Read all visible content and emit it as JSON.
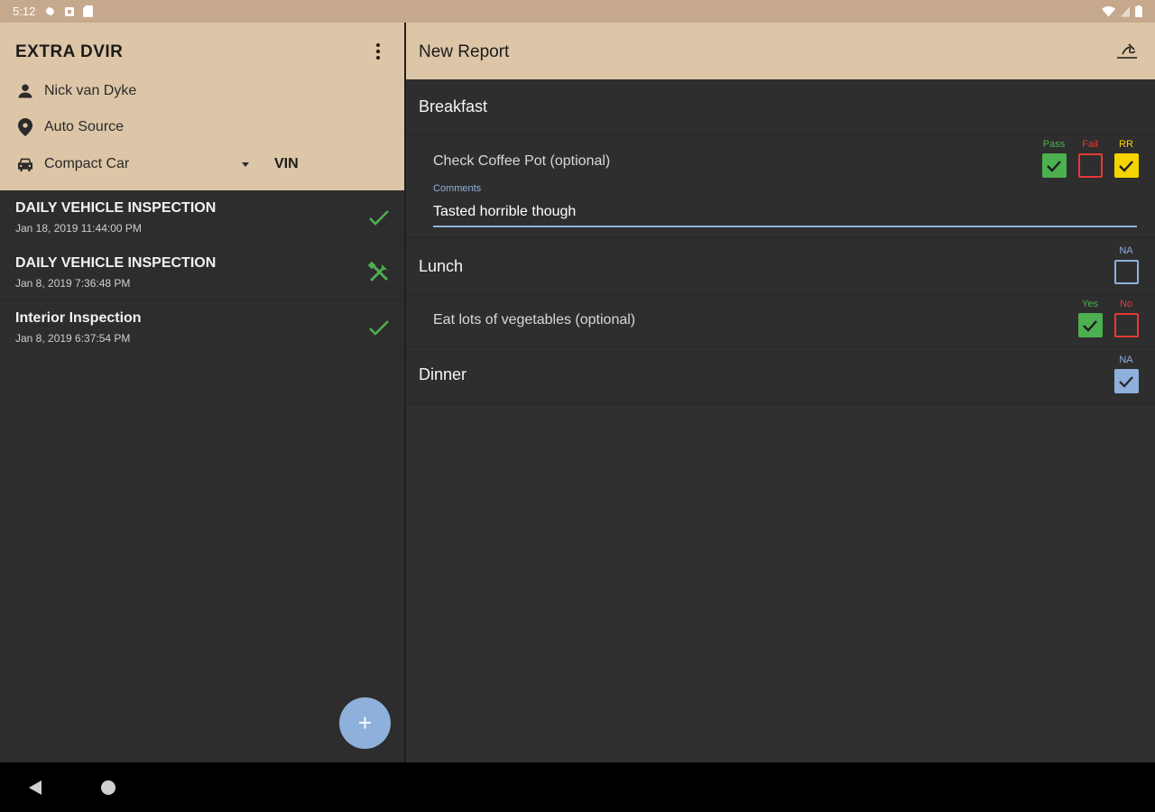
{
  "status_bar": {
    "time": "5:12"
  },
  "left_panel": {
    "app_title": "EXTRA DVIR",
    "driver_name": "Nick van Dyke",
    "location_source": "Auto Source",
    "vehicle": "Compact Car",
    "vin_label": "VIN",
    "inspections": [
      {
        "title": "DAILY VEHICLE INSPECTION",
        "date": "Jan 18, 2019 11:44:00 PM",
        "status_icon": "check-icon"
      },
      {
        "title": "DAILY VEHICLE INSPECTION",
        "date": "Jan 8, 2019 7:36:48 PM",
        "status_icon": "tools-icon"
      },
      {
        "title": "Interior Inspection",
        "date": "Jan 8, 2019 6:37:54 PM",
        "status_icon": "check-icon"
      }
    ],
    "fab_label": "+"
  },
  "right_panel": {
    "title": "New Report",
    "sections": {
      "breakfast": {
        "title": "Breakfast",
        "item_label": "Check Coffee Pot (optional)",
        "options": [
          {
            "label": "Pass",
            "checked": true,
            "color": "#4caf50"
          },
          {
            "label": "Fail",
            "checked": false,
            "color": "#e53935"
          },
          {
            "label": "RR",
            "checked": true,
            "color": "#f5d400"
          }
        ],
        "comment_caption": "Comments",
        "comment_value": "Tasted horrible though"
      },
      "lunch": {
        "title": "Lunch",
        "na_label": "NA",
        "na_checked": false,
        "item_label": "Eat lots of vegetables (optional)",
        "options": [
          {
            "label": "Yes",
            "checked": true,
            "color": "#4caf50"
          },
          {
            "label": "No",
            "checked": false,
            "color": "#e53935"
          }
        ]
      },
      "dinner": {
        "title": "Dinner",
        "na_label": "NA",
        "na_checked": true
      }
    }
  },
  "colors": {
    "header_bg": "#dcc6a7",
    "status_bar_bg": "#c6a88c",
    "panel_bg": "#2d2d2d",
    "accent_blue": "#8eb1dc",
    "pass_green": "#4caf50",
    "fail_red": "#e53935",
    "rr_yellow": "#f5d400"
  }
}
